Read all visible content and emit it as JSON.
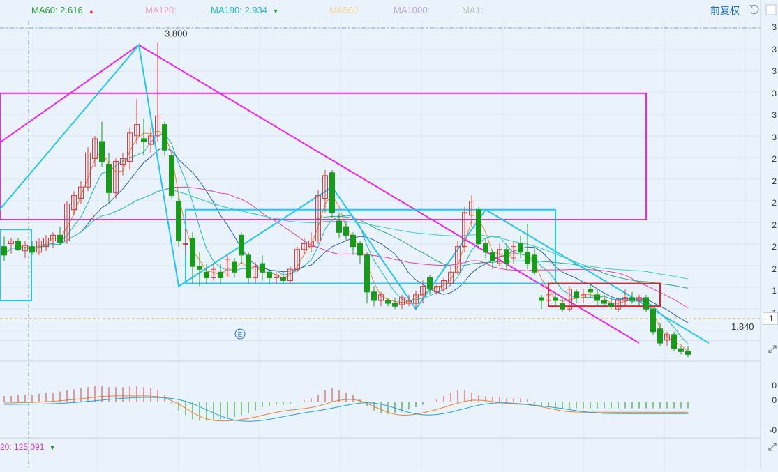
{
  "legend": {
    "items": [
      {
        "name": "MA60",
        "value": "MA60: 2.616",
        "color": "#2a9d3c",
        "arrow": "up",
        "arrow_color": "#e03030"
      },
      {
        "name": "MA120",
        "value": "MA120:",
        "color": "#f2a0c0"
      },
      {
        "name": "MA190",
        "value": "MA190: 2.934",
        "color": "#1fb5c8",
        "arrow": "down",
        "arrow_color": "#1a9a1a"
      },
      {
        "name": "MA500",
        "value": "MA500",
        "color": "#f5d69a"
      },
      {
        "name": "MA1000",
        "value": "MA1000:",
        "color": "#b9a7e0"
      },
      {
        "name": "MA1",
        "value": "MA1:",
        "color": "#bcbcbc"
      }
    ],
    "up_arrow": "▲",
    "down_arrow": "▼"
  },
  "toolbar": {
    "adjust_label": "前复权",
    "undo_icon": "undo-icon",
    "menu_icon": "controls-icon"
  },
  "annotations": {
    "high_label": "3.800",
    "last_price_label": "1.840",
    "event_marker": "E"
  },
  "right_axis": {
    "main_ticks": [
      "3",
      "3",
      "3",
      "3",
      "3",
      "3",
      "2",
      "2",
      "2",
      "2",
      "2",
      "2",
      "1",
      "1"
    ],
    "current_price_tag": "1",
    "macd_ticks": [
      "0",
      "0",
      "-0"
    ]
  },
  "bottom_legend": {
    "text": "20: 125.091",
    "arrow": "▼",
    "arrow_color": "#1a9a1a"
  },
  "colors": {
    "up": "#e03a3a",
    "down": "#1a9a1a",
    "pattern_magenta": "#ee22ee",
    "pattern_cyan": "#22c6f0",
    "range_box": "#e82020",
    "background": "#eaf3fb",
    "grid": "#d9e6f2"
  },
  "chart_data": {
    "type": "candlestick",
    "price_axis": {
      "min": 1.7,
      "max": 3.95
    },
    "candles": [
      {
        "o": 2.36,
        "h": 2.43,
        "l": 2.26,
        "c": 2.3
      },
      {
        "o": 2.38,
        "h": 2.42,
        "l": 2.31,
        "c": 2.4
      },
      {
        "o": 2.4,
        "h": 2.42,
        "l": 2.33,
        "c": 2.34
      },
      {
        "o": 2.33,
        "h": 2.4,
        "l": 2.28,
        "c": 2.37
      },
      {
        "o": 2.36,
        "h": 2.4,
        "l": 2.3,
        "c": 2.32
      },
      {
        "o": 2.32,
        "h": 2.42,
        "l": 2.3,
        "c": 2.4
      },
      {
        "o": 2.36,
        "h": 2.44,
        "l": 2.33,
        "c": 2.42
      },
      {
        "o": 2.4,
        "h": 2.46,
        "l": 2.35,
        "c": 2.44
      },
      {
        "o": 2.44,
        "h": 2.5,
        "l": 2.37,
        "c": 2.39
      },
      {
        "o": 2.4,
        "h": 2.68,
        "l": 2.38,
        "c": 2.66
      },
      {
        "o": 2.62,
        "h": 2.75,
        "l": 2.58,
        "c": 2.72
      },
      {
        "o": 2.7,
        "h": 2.82,
        "l": 2.66,
        "c": 2.78
      },
      {
        "o": 2.78,
        "h": 3.06,
        "l": 2.75,
        "c": 3.02
      },
      {
        "o": 2.98,
        "h": 3.14,
        "l": 2.92,
        "c": 3.12
      },
      {
        "o": 3.1,
        "h": 3.24,
        "l": 2.92,
        "c": 2.96
      },
      {
        "o": 2.94,
        "h": 3.02,
        "l": 2.66,
        "c": 2.74
      },
      {
        "o": 2.74,
        "h": 2.98,
        "l": 2.7,
        "c": 2.96
      },
      {
        "o": 2.94,
        "h": 3.02,
        "l": 2.86,
        "c": 2.98
      },
      {
        "o": 2.96,
        "h": 3.2,
        "l": 2.9,
        "c": 3.16
      },
      {
        "o": 3.14,
        "h": 3.4,
        "l": 3.08,
        "c": 3.22
      },
      {
        "o": 3.12,
        "h": 3.26,
        "l": 3.0,
        "c": 3.1
      },
      {
        "o": 3.08,
        "h": 3.2,
        "l": 3.02,
        "c": 3.14
      },
      {
        "o": 3.14,
        "h": 3.8,
        "l": 3.1,
        "c": 3.28
      },
      {
        "o": 3.22,
        "h": 3.24,
        "l": 3.0,
        "c": 3.04
      },
      {
        "o": 3.0,
        "h": 3.02,
        "l": 2.7,
        "c": 2.72
      },
      {
        "o": 2.68,
        "h": 2.72,
        "l": 2.36,
        "c": 2.4
      },
      {
        "o": 2.38,
        "h": 2.48,
        "l": 2.3,
        "c": 2.38
      },
      {
        "o": 2.42,
        "h": 2.46,
        "l": 2.1,
        "c": 2.22
      },
      {
        "o": 2.22,
        "h": 2.32,
        "l": 2.08,
        "c": 2.2
      },
      {
        "o": 2.18,
        "h": 2.24,
        "l": 2.1,
        "c": 2.14
      },
      {
        "o": 2.14,
        "h": 2.24,
        "l": 2.12,
        "c": 2.2
      },
      {
        "o": 2.18,
        "h": 2.24,
        "l": 2.1,
        "c": 2.14
      },
      {
        "o": 2.16,
        "h": 2.3,
        "l": 2.14,
        "c": 2.27
      },
      {
        "o": 2.25,
        "h": 2.28,
        "l": 2.14,
        "c": 2.18
      },
      {
        "o": 2.44,
        "h": 2.46,
        "l": 2.24,
        "c": 2.3
      },
      {
        "o": 2.3,
        "h": 2.32,
        "l": 2.1,
        "c": 2.14
      },
      {
        "o": 2.14,
        "h": 2.25,
        "l": 2.1,
        "c": 2.22
      },
      {
        "o": 2.24,
        "h": 2.3,
        "l": 2.12,
        "c": 2.18
      },
      {
        "o": 2.18,
        "h": 2.2,
        "l": 2.1,
        "c": 2.14
      },
      {
        "o": 2.14,
        "h": 2.18,
        "l": 2.1,
        "c": 2.16
      },
      {
        "o": 2.14,
        "h": 2.18,
        "l": 2.1,
        "c": 2.12
      },
      {
        "o": 2.12,
        "h": 2.22,
        "l": 2.1,
        "c": 2.2
      },
      {
        "o": 2.2,
        "h": 2.36,
        "l": 2.18,
        "c": 2.34
      },
      {
        "o": 2.34,
        "h": 2.42,
        "l": 2.3,
        "c": 2.38
      },
      {
        "o": 2.36,
        "h": 2.46,
        "l": 2.32,
        "c": 2.4
      },
      {
        "o": 2.4,
        "h": 2.76,
        "l": 2.38,
        "c": 2.72
      },
      {
        "o": 2.7,
        "h": 2.9,
        "l": 2.6,
        "c": 2.86
      },
      {
        "o": 2.88,
        "h": 2.9,
        "l": 2.56,
        "c": 2.6
      },
      {
        "o": 2.54,
        "h": 2.6,
        "l": 2.42,
        "c": 2.46
      },
      {
        "o": 2.5,
        "h": 2.54,
        "l": 2.4,
        "c": 2.44
      },
      {
        "o": 2.44,
        "h": 2.46,
        "l": 2.3,
        "c": 2.36
      },
      {
        "o": 2.38,
        "h": 2.4,
        "l": 2.24,
        "c": 2.3
      },
      {
        "o": 2.3,
        "h": 2.32,
        "l": 1.96,
        "c": 2.04
      },
      {
        "o": 2.04,
        "h": 2.08,
        "l": 1.94,
        "c": 1.98
      },
      {
        "o": 1.98,
        "h": 2.04,
        "l": 1.94,
        "c": 2.02
      },
      {
        "o": 1.98,
        "h": 2.0,
        "l": 1.94,
        "c": 1.96
      },
      {
        "o": 1.96,
        "h": 2.0,
        "l": 1.92,
        "c": 1.94
      },
      {
        "o": 1.95,
        "h": 2.02,
        "l": 1.92,
        "c": 2.0
      },
      {
        "o": 1.96,
        "h": 2.02,
        "l": 1.94,
        "c": 1.98
      },
      {
        "o": 1.96,
        "h": 2.05,
        "l": 1.92,
        "c": 2.02
      },
      {
        "o": 2.02,
        "h": 2.12,
        "l": 1.96,
        "c": 2.08
      },
      {
        "o": 2.14,
        "h": 2.16,
        "l": 2.02,
        "c": 2.06
      },
      {
        "o": 2.04,
        "h": 2.1,
        "l": 2.02,
        "c": 2.08
      },
      {
        "o": 2.06,
        "h": 2.14,
        "l": 2.04,
        "c": 2.12
      },
      {
        "o": 2.1,
        "h": 2.22,
        "l": 2.08,
        "c": 2.18
      },
      {
        "o": 2.18,
        "h": 2.4,
        "l": 2.16,
        "c": 2.36
      },
      {
        "o": 2.36,
        "h": 2.64,
        "l": 2.32,
        "c": 2.6
      },
      {
        "o": 2.58,
        "h": 2.72,
        "l": 2.5,
        "c": 2.68
      },
      {
        "o": 2.62,
        "h": 2.64,
        "l": 2.34,
        "c": 2.38
      },
      {
        "o": 2.38,
        "h": 2.42,
        "l": 2.28,
        "c": 2.32
      },
      {
        "o": 2.32,
        "h": 2.34,
        "l": 2.2,
        "c": 2.26
      },
      {
        "o": 2.24,
        "h": 2.38,
        "l": 2.22,
        "c": 2.34
      },
      {
        "o": 2.34,
        "h": 2.38,
        "l": 2.2,
        "c": 2.24
      },
      {
        "o": 2.28,
        "h": 2.4,
        "l": 2.24,
        "c": 2.36
      },
      {
        "o": 2.38,
        "h": 2.44,
        "l": 2.28,
        "c": 2.32
      },
      {
        "o": 2.32,
        "h": 2.52,
        "l": 2.2,
        "c": 2.24
      },
      {
        "o": 2.3,
        "h": 2.36,
        "l": 2.16,
        "c": 2.18
      },
      {
        "o": 2.0,
        "h": 2.02,
        "l": 1.92,
        "c": 1.98
      },
      {
        "o": 1.98,
        "h": 2.04,
        "l": 1.96,
        "c": 2.02
      },
      {
        "o": 2.0,
        "h": 2.04,
        "l": 1.94,
        "c": 1.98
      },
      {
        "o": 1.96,
        "h": 2.0,
        "l": 1.9,
        "c": 1.92
      },
      {
        "o": 1.92,
        "h": 2.08,
        "l": 1.9,
        "c": 2.06
      },
      {
        "o": 2.04,
        "h": 2.06,
        "l": 1.96,
        "c": 2.0
      },
      {
        "o": 2.0,
        "h": 2.06,
        "l": 1.96,
        "c": 2.02
      },
      {
        "o": 2.06,
        "h": 2.1,
        "l": 2.0,
        "c": 2.04
      },
      {
        "o": 2.02,
        "h": 2.06,
        "l": 1.94,
        "c": 1.98
      },
      {
        "o": 1.98,
        "h": 2.02,
        "l": 1.94,
        "c": 1.96
      },
      {
        "o": 1.96,
        "h": 2.0,
        "l": 1.92,
        "c": 1.94
      },
      {
        "o": 1.92,
        "h": 2.0,
        "l": 1.9,
        "c": 1.98
      },
      {
        "o": 1.98,
        "h": 2.06,
        "l": 1.94,
        "c": 2.0
      },
      {
        "o": 2.0,
        "h": 2.04,
        "l": 1.96,
        "c": 1.98
      },
      {
        "o": 1.98,
        "h": 2.02,
        "l": 1.94,
        "c": 2.0
      },
      {
        "o": 2.0,
        "h": 2.02,
        "l": 1.9,
        "c": 1.92
      },
      {
        "o": 1.92,
        "h": 1.94,
        "l": 1.74,
        "c": 1.76
      },
      {
        "o": 1.78,
        "h": 1.82,
        "l": 1.66,
        "c": 1.68
      },
      {
        "o": 1.7,
        "h": 1.76,
        "l": 1.66,
        "c": 1.74
      },
      {
        "o": 1.74,
        "h": 1.76,
        "l": 1.62,
        "c": 1.64
      },
      {
        "o": 1.64,
        "h": 1.66,
        "l": 1.6,
        "c": 1.62
      },
      {
        "o": 1.62,
        "h": 1.66,
        "l": 1.58,
        "c": 1.6
      }
    ],
    "macd": [
      0.05,
      0.05,
      0.06,
      0.06,
      0.06,
      0.07,
      0.08,
      0.08,
      0.09,
      0.1,
      0.11,
      0.12,
      0.13,
      0.14,
      0.14,
      0.13,
      0.13,
      0.13,
      0.14,
      0.14,
      0.13,
      0.12,
      0.1,
      0.06,
      -0.02,
      -0.08,
      -0.12,
      -0.16,
      -0.17,
      -0.17,
      -0.17,
      -0.16,
      -0.15,
      -0.14,
      -0.12,
      -0.1,
      -0.08,
      -0.05,
      -0.04,
      -0.03,
      -0.03,
      -0.02,
      -0.01,
      0.01,
      0.03,
      0.06,
      0.1,
      0.12,
      0.1,
      0.08,
      0.06,
      0.02,
      -0.04,
      -0.08,
      -0.1,
      -0.11,
      -0.1,
      -0.09,
      -0.07,
      -0.05,
      -0.03,
      0.0,
      0.02,
      0.05,
      0.08,
      0.1,
      0.1,
      0.08,
      0.06,
      0.05,
      0.04,
      0.04,
      0.03,
      0.03,
      0.03,
      0.02,
      -0.02,
      -0.04,
      -0.05,
      -0.06,
      -0.06,
      -0.06,
      -0.06,
      -0.06,
      -0.06,
      -0.06,
      -0.06,
      -0.06,
      -0.06,
      -0.06,
      -0.06,
      -0.06,
      -0.06,
      -0.06,
      -0.06,
      -0.06,
      -0.06,
      -0.06,
      -0.06,
      -0.06
    ]
  }
}
